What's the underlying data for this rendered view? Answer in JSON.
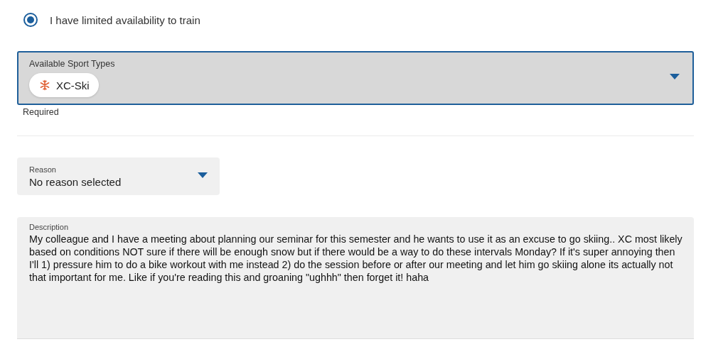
{
  "availability_option": {
    "label": "I have limited availability to train",
    "selected": true
  },
  "sport_types": {
    "label": "Available Sport Types",
    "focused": true,
    "chips": [
      {
        "label": "XC-Ski"
      }
    ],
    "helper": "Required"
  },
  "reason": {
    "label": "Reason",
    "value": "No reason selected"
  },
  "description": {
    "label": "Description",
    "value": "My colleague and I have a meeting about planning our seminar for this semester and he wants to use it as an excuse to go skiing.. XC most likely based on conditions NOT sure if there will be enough snow but if there would be a way to do these intervals Monday? If it's super annoying then I'll 1) pressure him to do a bike workout with me instead 2) do the session before or after our meeting and let him go skiing alone its actually not that important for me. Like if you're reading this and groaning \"ughhh\" then forget it! haha"
  }
}
